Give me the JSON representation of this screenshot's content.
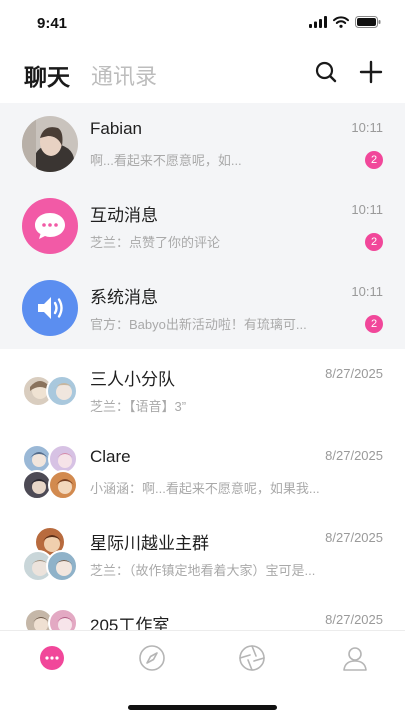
{
  "status_bar": {
    "time": "9:41"
  },
  "header": {
    "tab_chat": "聊天",
    "tab_contacts": "通讯录"
  },
  "colors": {
    "accent": "#f1479a",
    "interaction_avatar": "#f25aa6",
    "system_avatar": "#5b8ef0"
  },
  "conversations": [
    {
      "name": "Fabian",
      "preview": "啊...看起来不愿意呢，如...",
      "time": "10:11",
      "unread": "2"
    },
    {
      "name": "互动消息",
      "preview": "芝兰：点赞了你的评论",
      "time": "10:11",
      "unread": "2"
    },
    {
      "name": "系统消息",
      "preview": "官方：Babyo出新活动啦！有琉璃可...",
      "time": "10:11",
      "unread": "2"
    },
    {
      "name": "三人小分队",
      "preview": "芝兰：【语音】3”",
      "time": "8/27/2025"
    },
    {
      "name": "Clare",
      "preview": "小涵涵：啊...看起来不愿意呢，如果我...",
      "time": "8/27/2025"
    },
    {
      "name": "星际川越业主群",
      "preview": "芝兰：（故作镇定地看着大家）宝可是...",
      "time": "8/27/2025"
    },
    {
      "name": "205工作室",
      "preview": "",
      "time": "8/27/2025"
    }
  ],
  "tabbar": {
    "icons": [
      "chat-bubble-icon",
      "compass-icon",
      "aperture-icon",
      "profile-icon"
    ]
  }
}
